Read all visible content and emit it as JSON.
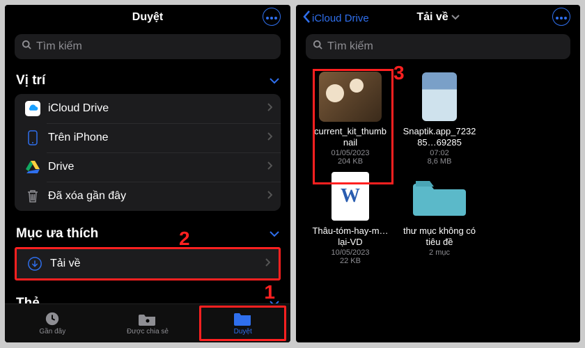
{
  "left": {
    "title": "Duyệt",
    "search_placeholder": "Tìm kiếm",
    "section_locations": "Vị trí",
    "locations": [
      {
        "label": "iCloud Drive"
      },
      {
        "label": "Trên iPhone"
      },
      {
        "label": "Drive"
      },
      {
        "label": "Đã xóa gần đây"
      }
    ],
    "section_favorites": "Mục ưa thích",
    "favorites": [
      {
        "label": "Tải về"
      }
    ],
    "section_tags": "Thẻ",
    "tabs": {
      "recent": "Gần đây",
      "shared": "Được chia sẻ",
      "browse": "Duyệt"
    }
  },
  "right": {
    "back_label": "iCloud Drive",
    "title": "Tải về",
    "search_placeholder": "Tìm kiếm",
    "items": [
      {
        "name": "current_kit_thumbnail",
        "meta1": "01/05/2023",
        "meta2": "204 KB"
      },
      {
        "name": "Snaptik.app_723285…69285",
        "meta1": "07:02",
        "meta2": "8,6 MB"
      },
      {
        "name": "Thâu-tóm-hay-m…lại-VD",
        "meta1": "10/05/2023",
        "meta2": "22 KB"
      },
      {
        "name": "thư mục không có tiêu đề",
        "meta1": "2 mục",
        "meta2": ""
      }
    ]
  },
  "annotations": {
    "a1": "1",
    "a2": "2",
    "a3": "3"
  }
}
